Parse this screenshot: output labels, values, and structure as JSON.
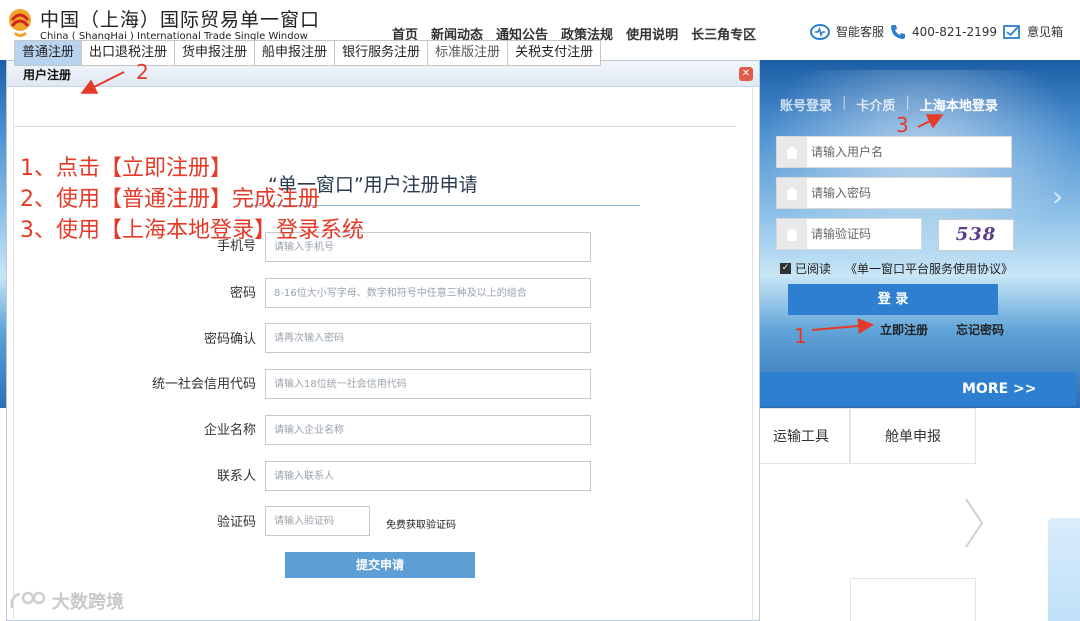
{
  "header": {
    "logo_cn": "中国（上海）国际贸易单一窗口",
    "logo_en": "China ( ShangHai ) International Trade Single Window",
    "nav": [
      "首页",
      "新闻动态",
      "通知公告",
      "政策法规",
      "使用说明",
      "长三角专区"
    ],
    "service": "智能客服",
    "phone": "400-821-2199",
    "feedback": "意见箱"
  },
  "login": {
    "tabs": [
      "账号登录",
      "卡介质",
      "上海本地登录"
    ],
    "username_placeholder": "请输入用户名",
    "password_placeholder": "请输入密码",
    "captcha_placeholder": "请输验证码",
    "captcha_text": "538",
    "agree_prefix": "已阅读",
    "agree_link": "《单一窗口平台服务使用协议》",
    "login_label": "登 录",
    "register_label": "立即注册",
    "forgot_label": "忘记密码",
    "more_label": "MORE >>"
  },
  "tiles": [
    "运输工具",
    "舱单申报"
  ],
  "modal": {
    "title": "用户注册",
    "tabs": [
      "普通注册",
      "出口退税注册",
      "货申报注册",
      "船申报注册",
      "银行服务注册",
      "标准版注册",
      "关税支付注册"
    ],
    "form_title": "“单一窗口”用户注册申请",
    "fields": [
      {
        "label": "手机号",
        "placeholder": "请输入手机号"
      },
      {
        "label": "密码",
        "placeholder": "8-16位大小写字母、数字和符号中任意三种及以上的组合"
      },
      {
        "label": "密码确认",
        "placeholder": "请再次输入密码"
      },
      {
        "label": "统一社会信用代码",
        "placeholder": "请输入18位统一社会信用代码"
      },
      {
        "label": "企业名称",
        "placeholder": "请输入企业名称"
      },
      {
        "label": "联系人",
        "placeholder": "请输入联系人"
      },
      {
        "label": "验证码",
        "placeholder": "请输入验证码"
      }
    ],
    "get_code_label": "免费获取验证码",
    "submit_label": "提交申请"
  },
  "annotations": {
    "steps": [
      "1、点击【立即注册】",
      "2、使用【普通注册】完成注册",
      "3、使用【上海本地登录】登录系统"
    ],
    "markers": [
      "1",
      "2",
      "3"
    ],
    "color": "#e53a28"
  },
  "watermark": "大数跨境"
}
